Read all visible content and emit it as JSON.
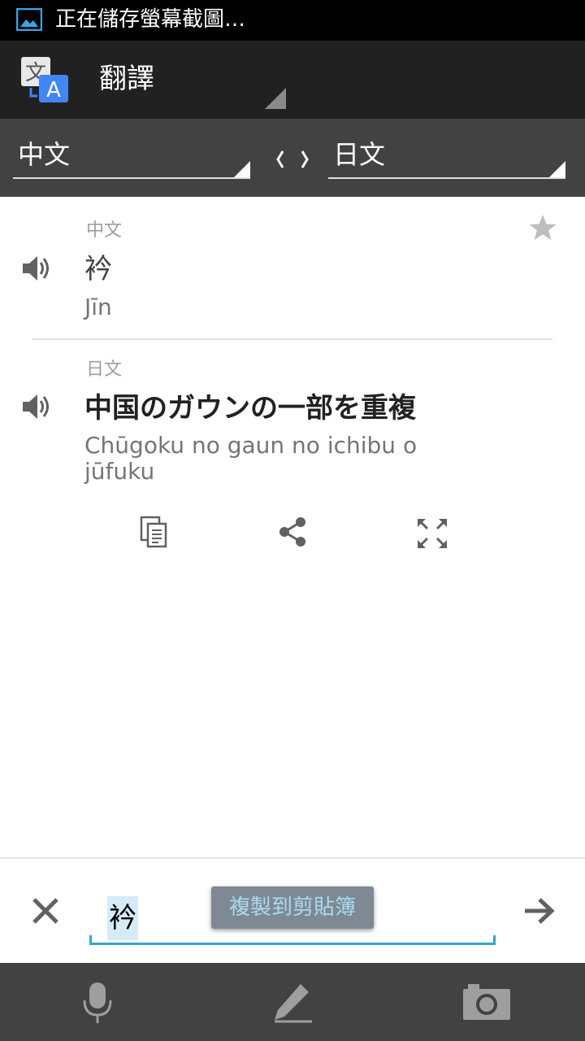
{
  "status_bar": {
    "notification_text": "正在儲存螢幕截圖…",
    "notification_icon": "image-icon"
  },
  "header": {
    "app_title": "翻譯",
    "logo_glyph_source": "文",
    "logo_glyph_target": "A"
  },
  "language_bar": {
    "source_language": "中文",
    "target_language": "日文",
    "swap_icon": "swap-languages-icon"
  },
  "result": {
    "source": {
      "language": "中文",
      "text": "衿",
      "transliteration": "Jīn"
    },
    "target": {
      "language": "日文",
      "text": "中国のガウンの一部を重複",
      "transliteration": "Chūgoku no gaun no ichibu o jūfuku"
    },
    "actions": [
      "copy-icon",
      "share-icon",
      "fullscreen-icon"
    ],
    "favorite_icon": "star-icon"
  },
  "input": {
    "value": "衿",
    "context_popup": "複製到剪貼簿",
    "clear_icon": "close-icon",
    "submit_icon": "arrow-right-icon"
  },
  "bottom_toolbar": {
    "buttons": [
      "microphone-icon",
      "pencil-icon",
      "camera-icon"
    ]
  },
  "colors": {
    "status_bar": "#000000",
    "action_bar": "#212121",
    "language_bar": "#424242",
    "accent": "#3aa3c9",
    "logo_blue": "#4285f4",
    "popup": "#7f8994"
  }
}
